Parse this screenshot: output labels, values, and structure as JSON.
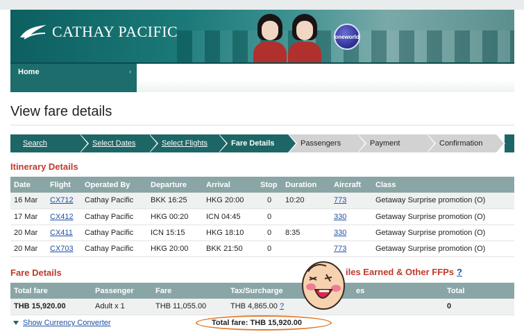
{
  "brand": {
    "name": "CATHAY PACIFIC",
    "oneworld": "oneworld"
  },
  "nav": {
    "home": "Home",
    "home_arrow": "›"
  },
  "page_title": "View fare details",
  "steps": [
    {
      "label": "Search",
      "state": "done"
    },
    {
      "label": "Select Dates",
      "state": "done"
    },
    {
      "label": "Select Flights",
      "state": "done"
    },
    {
      "label": "Fare Details",
      "state": "current"
    },
    {
      "label": "Passengers",
      "state": "todo"
    },
    {
      "label": "Payment",
      "state": "todo"
    },
    {
      "label": "Confirmation",
      "state": "todo"
    }
  ],
  "itinerary": {
    "title": "Itinerary Details",
    "columns": [
      "Date",
      "Flight",
      "Operated By",
      "Departure",
      "Arrival",
      "Stop",
      "Duration",
      "Aircraft",
      "Class"
    ],
    "rows": [
      {
        "date": "16 Mar",
        "flight": "CX712",
        "operated_by": "Cathay Pacific",
        "departure": "BKK 16:25",
        "arrival": "HKG 20:00",
        "stop": "0",
        "duration": "10:20",
        "aircraft": "773",
        "class": "Getaway Surprise promotion (O)"
      },
      {
        "date": "17 Mar",
        "flight": "CX412",
        "operated_by": "Cathay Pacific",
        "departure": "HKG 00:20",
        "arrival": "ICN 04:45",
        "stop": "0",
        "duration": "",
        "aircraft": "330",
        "class": "Getaway Surprise promotion (O)"
      },
      {
        "date": "20 Mar",
        "flight": "CX411",
        "operated_by": "Cathay Pacific",
        "departure": "ICN 15:15",
        "arrival": "HKG 18:10",
        "stop": "0",
        "duration": "8:35",
        "aircraft": "330",
        "class": "Getaway Surprise promotion (O)"
      },
      {
        "date": "20 Mar",
        "flight": "CX703",
        "operated_by": "Cathay Pacific",
        "departure": "HKG 20:00",
        "arrival": "BKK 21:50",
        "stop": "0",
        "duration": "",
        "aircraft": "773",
        "class": "Getaway Surprise promotion (O)"
      }
    ]
  },
  "fare": {
    "title": "Fare Details",
    "columns": [
      "Total fare",
      "Passenger",
      "Fare",
      "Tax/Surcharge",
      "es",
      "Total"
    ],
    "row": {
      "total_fare": "THB 15,920.00",
      "passenger": "Adult x 1",
      "fare": "THB 11,055.00",
      "tax": "THB 4,865.00",
      "tax_help": "?",
      "miles": "",
      "total": "0"
    },
    "show_currency": "Show Currency Converter",
    "total_summary": "Total fare: THB 15,920.00"
  },
  "ffp": {
    "title": "iles Earned & Other FFPs",
    "help": "?"
  },
  "colors": {
    "teal": "#1e6666",
    "section_red": "#c0392b",
    "table_header": "#8aa5a6",
    "highlight_orange": "#e07a2e"
  }
}
